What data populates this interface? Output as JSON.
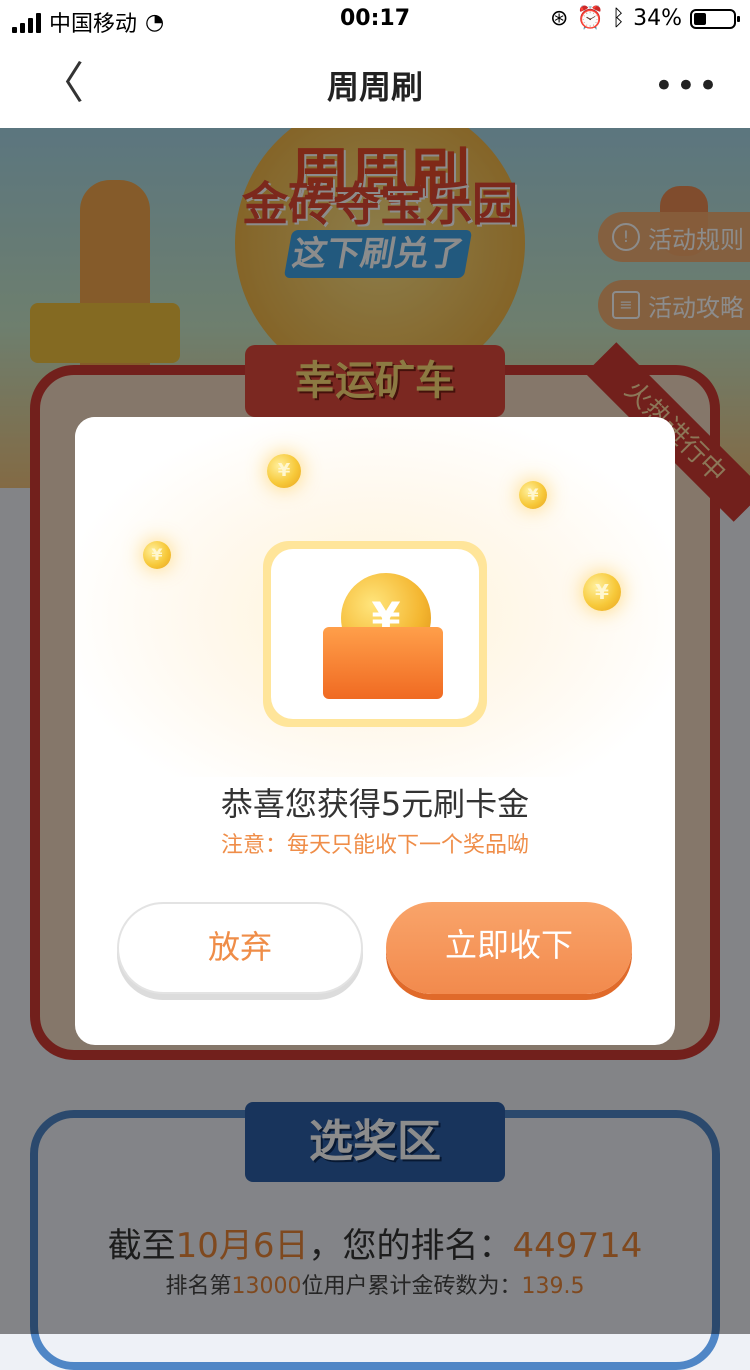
{
  "status_bar": {
    "carrier": "中国移动",
    "time": "00:17",
    "battery": "34%"
  },
  "nav": {
    "back_glyph": "〈",
    "title": "周周刷",
    "more_glyph": "•••"
  },
  "banner": {
    "title_line1": "周周刷",
    "title_line2": "金砖夺宝乐园",
    "subtitle": "这下刷兑了",
    "rules_button": "活动规则",
    "strategy_button": "活动攻略"
  },
  "section_mining": {
    "title": "幸运矿车",
    "ribbon": "火热进行中"
  },
  "modal": {
    "title": "恭喜您获得5元刷卡金",
    "note": "注意：每天只能收下一个奖品呦",
    "cancel_label": "放弃",
    "confirm_label": "立即收下",
    "coin_symbol": "¥"
  },
  "section_prize": {
    "title": "选奖区",
    "rank_prefix": "截至",
    "rank_date": "10月6日",
    "rank_mid": "，您的排名：",
    "rank_value": "449714",
    "rank2_prefix": "排名第",
    "rank2_position": "13000",
    "rank2_mid": "位用户累计金砖数为：",
    "rank2_value": "139.5"
  },
  "colors": {
    "accent_orange": "#f28a4d",
    "card_red": "#cf3b33",
    "prize_blue": "#2d5fa8"
  }
}
